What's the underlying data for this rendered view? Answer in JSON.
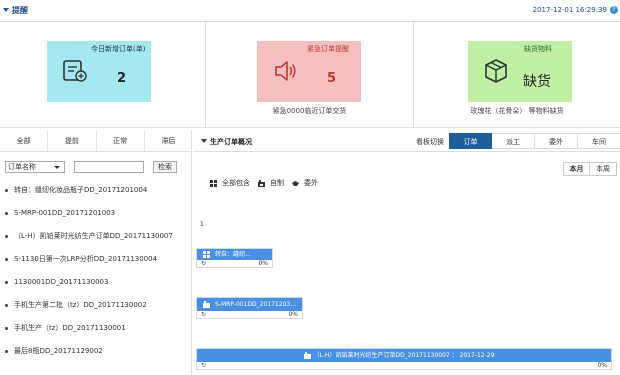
{
  "header": {
    "title": "提醒",
    "datetime": "2017-12-01 16:29:39",
    "help": "?"
  },
  "cards": [
    {
      "label": "今日新增订单(单)",
      "value": "2",
      "sub": ""
    },
    {
      "label": "紧急订单提醒",
      "value": "5",
      "sub": "紧急0000临近订单交货"
    },
    {
      "label": "缺货物料",
      "value": "缺货",
      "sub": "玫瑰花（花骨朵） 等物料缺货"
    }
  ],
  "left": {
    "tabs": [
      "全部",
      "提前",
      "正常",
      "滞后"
    ],
    "filter": "订单名称",
    "search_btn": "检索",
    "orders": [
      "转自：缝纫化妆品瓶子DD_20171201004",
      "S-MRP-001DD_20171201003",
      "（L-H）凯铂莱时光纺生产订单DD_20171130007",
      "S-1130日第一次LRP分析DD_20171130004",
      "1130001DD_20171130003",
      "手机生产第二批（tz）DD_20171130002",
      "手机生产（tz）DD_20171130001",
      "最后8瓶DD_20171129002"
    ]
  },
  "right": {
    "title": "生产订单概况",
    "switch_label": "看板切换",
    "view_tabs": [
      "订单",
      "派工",
      "委外",
      "车间"
    ],
    "active_view": 0,
    "periods": [
      "本月",
      "本周"
    ],
    "active_period": 0,
    "legend": [
      "全部包含",
      "自制",
      "委外"
    ],
    "row_mark": "1",
    "gantt": [
      {
        "label": "转自：缝纫…",
        "percent": "0%"
      },
      {
        "label": "S-MRP-001DD_20171203…",
        "percent": "0%"
      },
      {
        "label": "（L-H）凯铂莱时光纺生产订单DD_20171130007 ： 2017-12-29",
        "percent": "0%"
      }
    ]
  }
}
